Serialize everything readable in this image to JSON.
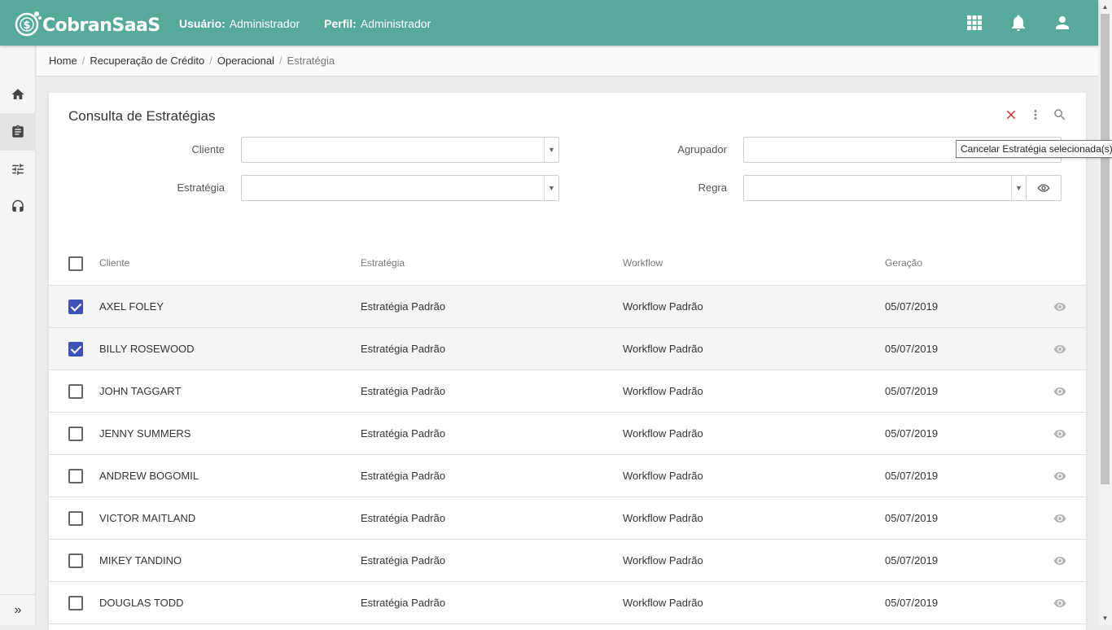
{
  "header": {
    "brand": "CobranSaaS",
    "usuario_label": "Usuário:",
    "usuario_value": "Administrador",
    "perfil_label": "Perfil:",
    "perfil_value": "Administrador",
    "bg_color": "#57a99a",
    "icons": [
      "apps-grid-icon",
      "bell-icon",
      "account-icon"
    ]
  },
  "sidebar": {
    "items": [
      {
        "name": "home-icon",
        "active": false
      },
      {
        "name": "clipboard-icon",
        "active": true
      },
      {
        "name": "sliders-icon",
        "active": false
      },
      {
        "name": "headset-icon",
        "active": false
      }
    ],
    "expand_glyph": "»"
  },
  "breadcrumb": {
    "items": [
      "Home",
      "Recuperação de Crédito",
      "Operacional",
      "Estratégia"
    ],
    "separator": "/"
  },
  "card": {
    "title": "Consulta de Estratégias",
    "tooltip": "Cancelar Estratégia selecionada(s)"
  },
  "filters": {
    "cliente_label": "Cliente",
    "cliente_value": "",
    "estrategia_label": "Estratégia",
    "estrategia_value": "",
    "agrupador_label": "Agrupador",
    "agrupador_value": "",
    "regra_label": "Regra",
    "regra_value": ""
  },
  "table": {
    "headers": {
      "cliente": "Cliente",
      "estrategia": "Estratégia",
      "workflow": "Workflow",
      "geracao": "Geração"
    },
    "rows": [
      {
        "cliente": "AXEL FOLEY",
        "estrategia": "Estratégia Padrão",
        "workflow": "Workflow Padrão",
        "geracao": "05/07/2019",
        "checked": true
      },
      {
        "cliente": "BILLY ROSEWOOD",
        "estrategia": "Estratégia Padrão",
        "workflow": "Workflow Padrão",
        "geracao": "05/07/2019",
        "checked": true
      },
      {
        "cliente": "JOHN TAGGART",
        "estrategia": "Estratégia Padrão",
        "workflow": "Workflow Padrão",
        "geracao": "05/07/2019",
        "checked": false
      },
      {
        "cliente": "JENNY SUMMERS",
        "estrategia": "Estratégia Padrão",
        "workflow": "Workflow Padrão",
        "geracao": "05/07/2019",
        "checked": false
      },
      {
        "cliente": "ANDREW BOGOMIL",
        "estrategia": "Estratégia Padrão",
        "workflow": "Workflow Padrão",
        "geracao": "05/07/2019",
        "checked": false
      },
      {
        "cliente": "VICTOR MAITLAND",
        "estrategia": "Estratégia Padrão",
        "workflow": "Workflow Padrão",
        "geracao": "05/07/2019",
        "checked": false
      },
      {
        "cliente": "MIKEY TANDINO",
        "estrategia": "Estratégia Padrão",
        "workflow": "Workflow Padrão",
        "geracao": "05/07/2019",
        "checked": false
      },
      {
        "cliente": "DOUGLAS TODD",
        "estrategia": "Estratégia Padrão",
        "workflow": "Workflow Padrão",
        "geracao": "05/07/2019",
        "checked": false
      }
    ]
  },
  "colors": {
    "accent": "#3f51b5",
    "cancel": "#d32f2f",
    "header": "#57a99a"
  }
}
